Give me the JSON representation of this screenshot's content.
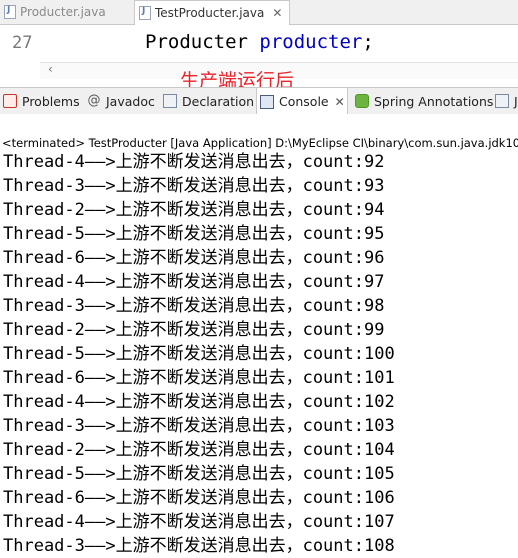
{
  "editor": {
    "tabs": [
      {
        "label": "Producter.java",
        "active": false
      },
      {
        "label": "TestProducter.java",
        "active": true,
        "close": "✕"
      }
    ],
    "line_number": "27",
    "code_type": "Producter",
    "code_var": "producter",
    "code_end": ";",
    "scroll_left_arrow": "‹"
  },
  "annotation": "生产端运行后",
  "views": {
    "tabs": [
      {
        "label": "Problems",
        "icon": "problems-icon"
      },
      {
        "label": "Javadoc",
        "icon": "at-sign-icon",
        "glyph": "@"
      },
      {
        "label": "Declaration",
        "icon": "declaration-icon"
      },
      {
        "label": "Console",
        "icon": "console-icon",
        "active": true,
        "close": "✕"
      },
      {
        "label": "Spring Annotations",
        "icon": "spring-icon"
      },
      {
        "label": "J",
        "icon": "view-icon"
      }
    ]
  },
  "console": {
    "status": "<terminated> TestProducter [Java Application] D:\\MyEclipse CI\\binary\\com.sun.java.jdk10",
    "lines": [
      "Thread-4——>上游不断发送消息出去，count:92",
      "Thread-3——>上游不断发送消息出去，count:93",
      "Thread-2——>上游不断发送消息出去，count:94",
      "Thread-5——>上游不断发送消息出去，count:95",
      "Thread-6——>上游不断发送消息出去，count:96",
      "Thread-4——>上游不断发送消息出去，count:97",
      "Thread-3——>上游不断发送消息出去，count:98",
      "Thread-2——>上游不断发送消息出去，count:99",
      "Thread-5——>上游不断发送消息出去，count:100",
      "Thread-6——>上游不断发送消息出去，count:101",
      "Thread-4——>上游不断发送消息出去，count:102",
      "Thread-3——>上游不断发送消息出去，count:103",
      "Thread-2——>上游不断发送消息出去，count:104",
      "Thread-5——>上游不断发送消息出去，count:105",
      "Thread-6——>上游不断发送消息出去，count:106",
      "Thread-4——>上游不断发送消息出去，count:107",
      "Thread-3——>上游不断发送消息出去，count:108"
    ]
  },
  "colors": {
    "annotation": "#e8232a",
    "keyword_var": "#0000c0",
    "tab_bar": "#f0f0f0"
  }
}
